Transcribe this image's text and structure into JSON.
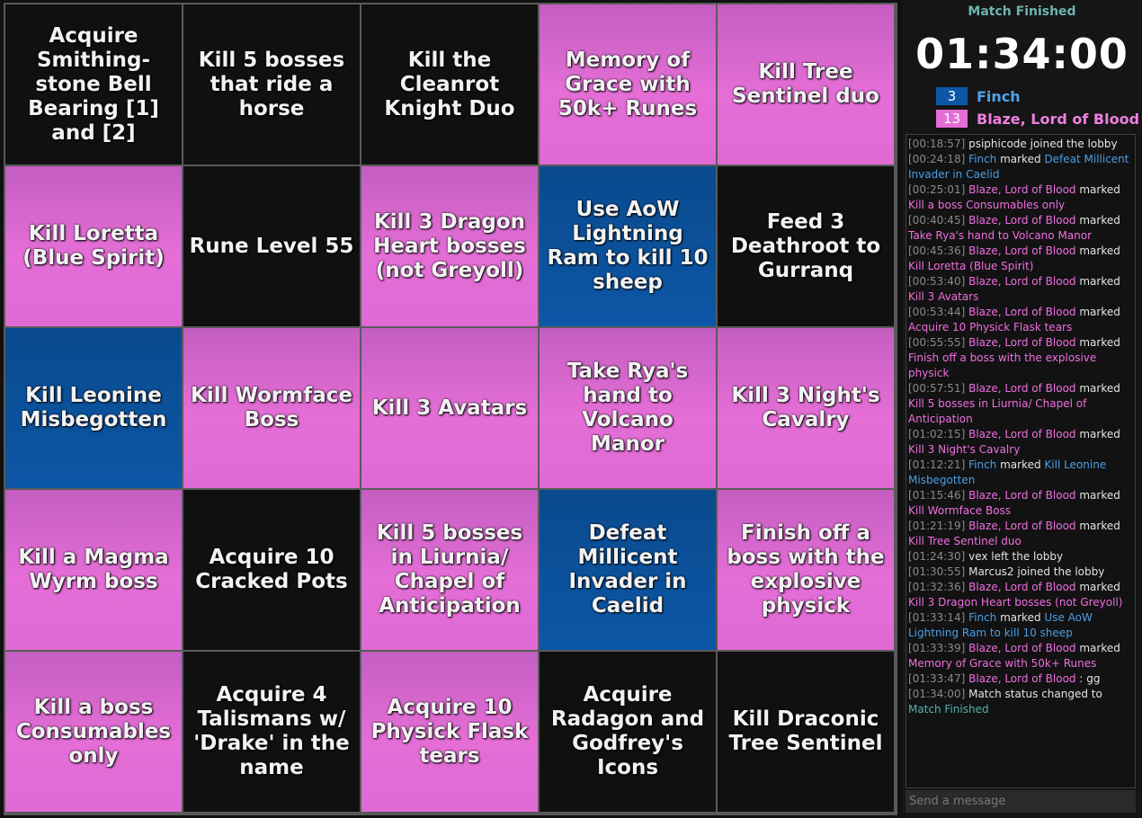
{
  "match": {
    "status": "Match Finished",
    "timer": "01:34:00"
  },
  "players": [
    {
      "score": "3",
      "name": "Finch",
      "color": "#0c57a6"
    },
    {
      "score": "13",
      "name": "Blaze, Lord of Blood",
      "color": "#e46ed6"
    }
  ],
  "board": [
    {
      "text": "Acquire Smithing-stone Bell Bearing [1] and [2]",
      "owner": "none"
    },
    {
      "text": "Kill 5 bosses that ride a horse",
      "owner": "none"
    },
    {
      "text": "Kill the Cleanrot Knight Duo",
      "owner": "none"
    },
    {
      "text": "Memory of Grace with 50k+ Runes",
      "owner": "pink"
    },
    {
      "text": "Kill Tree Sentinel duo",
      "owner": "pink"
    },
    {
      "text": "Kill Loretta (Blue Spirit)",
      "owner": "pink"
    },
    {
      "text": "Rune Level 55",
      "owner": "none"
    },
    {
      "text": "Kill 3 Dragon Heart bosses (not Greyoll)",
      "owner": "pink"
    },
    {
      "text": "Use AoW Lightning Ram to kill 10 sheep",
      "owner": "blue"
    },
    {
      "text": "Feed 3 Deathroot to Gurranq",
      "owner": "none"
    },
    {
      "text": "Kill Leonine Misbegotten",
      "owner": "blue"
    },
    {
      "text": "Kill Wormface Boss",
      "owner": "pink"
    },
    {
      "text": "Kill 3 Avatars",
      "owner": "pink"
    },
    {
      "text": "Take Rya's hand to Volcano Manor",
      "owner": "pink"
    },
    {
      "text": "Kill 3 Night's Cavalry",
      "owner": "pink"
    },
    {
      "text": "Kill a Magma Wyrm boss",
      "owner": "pink"
    },
    {
      "text": "Acquire 10 Cracked Pots",
      "owner": "none"
    },
    {
      "text": "Kill 5 bosses in Liurnia/ Chapel of Anticipation",
      "owner": "pink"
    },
    {
      "text": "Defeat Millicent Invader in Caelid",
      "owner": "blue"
    },
    {
      "text": "Finish off a boss with the explosive physick",
      "owner": "pink"
    },
    {
      "text": "Kill a boss Consumables only",
      "owner": "pink"
    },
    {
      "text": "Acquire 4 Talismans w/ 'Drake' in the name",
      "owner": "none"
    },
    {
      "text": "Acquire 10 Physick Flask tears",
      "owner": "pink"
    },
    {
      "text": "Acquire Radagon and Godfrey's Icons",
      "owner": "none"
    },
    {
      "text": "Kill Draconic Tree Sentinel",
      "owner": "none"
    }
  ],
  "log": [
    {
      "time": "[00:18:57]",
      "who": "psiphicode",
      "who_color": "plain",
      "action": " joined the lobby",
      "goal": "",
      "goal_color": ""
    },
    {
      "time": "[00:24:18]",
      "who": "Finch",
      "who_color": "blue",
      "action": " marked ",
      "goal": "Defeat Millicent Invader in Caelid",
      "goal_color": "blue"
    },
    {
      "time": "[00:25:01]",
      "who": "Blaze, Lord of Blood",
      "who_color": "pink",
      "action": " marked ",
      "goal": "Kill a boss Consumables only",
      "goal_color": "pink"
    },
    {
      "time": "[00:40:45]",
      "who": "Blaze, Lord of Blood",
      "who_color": "pink",
      "action": " marked ",
      "goal": "Take Rya's hand to Volcano Manor",
      "goal_color": "pink"
    },
    {
      "time": "[00:45:36]",
      "who": "Blaze, Lord of Blood",
      "who_color": "pink",
      "action": " marked ",
      "goal": "Kill Loretta (Blue Spirit)",
      "goal_color": "pink"
    },
    {
      "time": "[00:53:40]",
      "who": "Blaze, Lord of Blood",
      "who_color": "pink",
      "action": " marked ",
      "goal": "Kill 3 Avatars",
      "goal_color": "pink"
    },
    {
      "time": "[00:53:44]",
      "who": "Blaze, Lord of Blood",
      "who_color": "pink",
      "action": " marked ",
      "goal": "Acquire 10 Physick Flask tears",
      "goal_color": "pink"
    },
    {
      "time": "[00:55:55]",
      "who": "Blaze, Lord of Blood",
      "who_color": "pink",
      "action": " marked ",
      "goal": "Finish off a boss with the explosive physick",
      "goal_color": "pink"
    },
    {
      "time": "[00:57:51]",
      "who": "Blaze, Lord of Blood",
      "who_color": "pink",
      "action": " marked ",
      "goal": "Kill 5 bosses in Liurnia/ Chapel of Anticipation",
      "goal_color": "pink"
    },
    {
      "time": "[01:02:15]",
      "who": "Blaze, Lord of Blood",
      "who_color": "pink",
      "action": " marked ",
      "goal": "Kill 3 Night's Cavalry",
      "goal_color": "pink"
    },
    {
      "time": "[01:12:21]",
      "who": "Finch",
      "who_color": "blue",
      "action": " marked ",
      "goal": "Kill Leonine Misbegotten",
      "goal_color": "blue"
    },
    {
      "time": "[01:15:46]",
      "who": "Blaze, Lord of Blood",
      "who_color": "pink",
      "action": " marked ",
      "goal": "Kill Wormface Boss",
      "goal_color": "pink"
    },
    {
      "time": "[01:21:19]",
      "who": "Blaze, Lord of Blood",
      "who_color": "pink",
      "action": " marked ",
      "goal": "Kill Tree Sentinel duo",
      "goal_color": "pink"
    },
    {
      "time": "[01:24:30]",
      "who": "vex",
      "who_color": "plain",
      "action": " left the lobby",
      "goal": "",
      "goal_color": ""
    },
    {
      "time": "[01:30:55]",
      "who": "Marcus2",
      "who_color": "plain",
      "action": " joined the lobby",
      "goal": "",
      "goal_color": ""
    },
    {
      "time": "[01:32:36]",
      "who": "Blaze, Lord of Blood",
      "who_color": "pink",
      "action": " marked ",
      "goal": "Kill 3 Dragon Heart bosses (not Greyoll)",
      "goal_color": "pink"
    },
    {
      "time": "[01:33:14]",
      "who": "Finch",
      "who_color": "blue",
      "action": " marked ",
      "goal": "Use AoW Lightning Ram to kill 10 sheep",
      "goal_color": "blue"
    },
    {
      "time": "[01:33:39]",
      "who": "Blaze, Lord of Blood",
      "who_color": "pink",
      "action": " marked ",
      "goal": "Memory of Grace with 50k+ Runes",
      "goal_color": "pink"
    },
    {
      "time": "[01:33:47]",
      "who": "Blaze, Lord of Blood",
      "who_color": "pink",
      "action": " : gg",
      "goal": "",
      "goal_color": ""
    },
    {
      "time": "[01:34:00]",
      "who": "Match status changed to ",
      "who_color": "plain",
      "action": "",
      "goal": "Match Finished",
      "goal_color": "teal"
    }
  ],
  "chat": {
    "placeholder": "Send a message"
  }
}
